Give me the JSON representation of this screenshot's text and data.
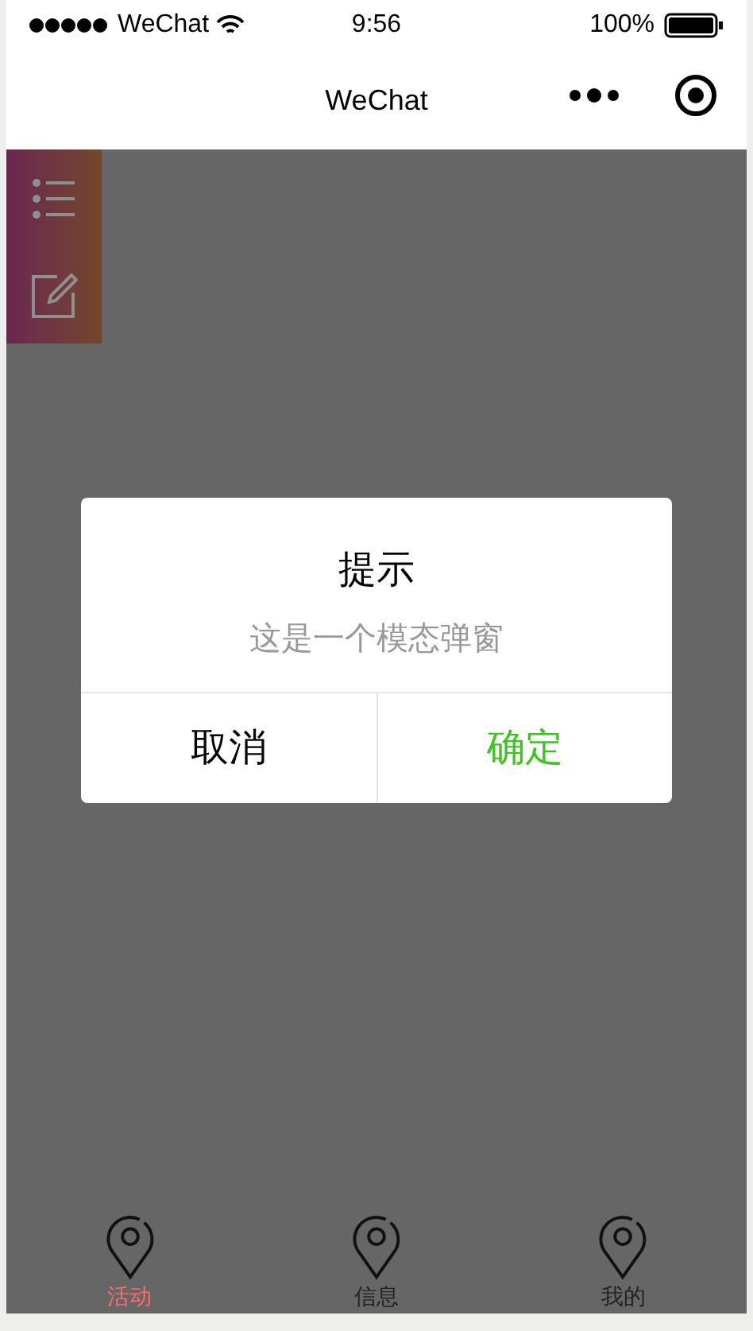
{
  "status_bar": {
    "carrier": "WeChat",
    "time": "9:56",
    "battery": "100%"
  },
  "nav_bar": {
    "title": "WeChat"
  },
  "side_buttons": [
    {
      "kind": "list"
    },
    {
      "kind": "edit"
    }
  ],
  "modal": {
    "title": "提示",
    "message": "这是一个模态弹窗",
    "buttons": [
      {
        "label": "取消",
        "kind": "cancel"
      },
      {
        "label": "确定",
        "kind": "confirm"
      }
    ]
  },
  "tab_bar": [
    {
      "label": "活动",
      "selected": true
    },
    {
      "label": "信息",
      "selected": false
    },
    {
      "label": "我的",
      "selected": false
    }
  ]
}
